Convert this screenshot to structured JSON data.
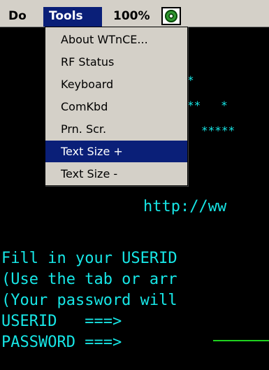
{
  "menubar": {
    "do_label": "Do",
    "tools_label": "Tools",
    "zoom_label": "100%",
    "status_icon": "connection-status-icon"
  },
  "dropdown": {
    "items": [
      {
        "label": "About WTnCE...",
        "selected": false
      },
      {
        "label": "RF Status",
        "selected": false
      },
      {
        "label": "Keyboard",
        "selected": false
      },
      {
        "label": "ComKbd",
        "selected": false
      },
      {
        "label": "Prn. Scr.",
        "selected": false
      },
      {
        "label": "Text Size +",
        "selected": true
      },
      {
        "label": "Text Size -",
        "selected": false
      }
    ]
  },
  "terminal": {
    "stars_row1": "*",
    "stars_row2": "**   *",
    "stars_row3": "*****",
    "url_fragment": "http://ww",
    "lines": [
      "Fill in your USERID",
      "(Use the tab or arr",
      "(Your password will",
      "USERID   ===>",
      "PASSWORD ===>"
    ]
  },
  "colors": {
    "terminal_text": "#17e6e6",
    "selection": "#0a1f78",
    "field_underline": "#1fd21f",
    "chrome": "#d4d0c8"
  }
}
